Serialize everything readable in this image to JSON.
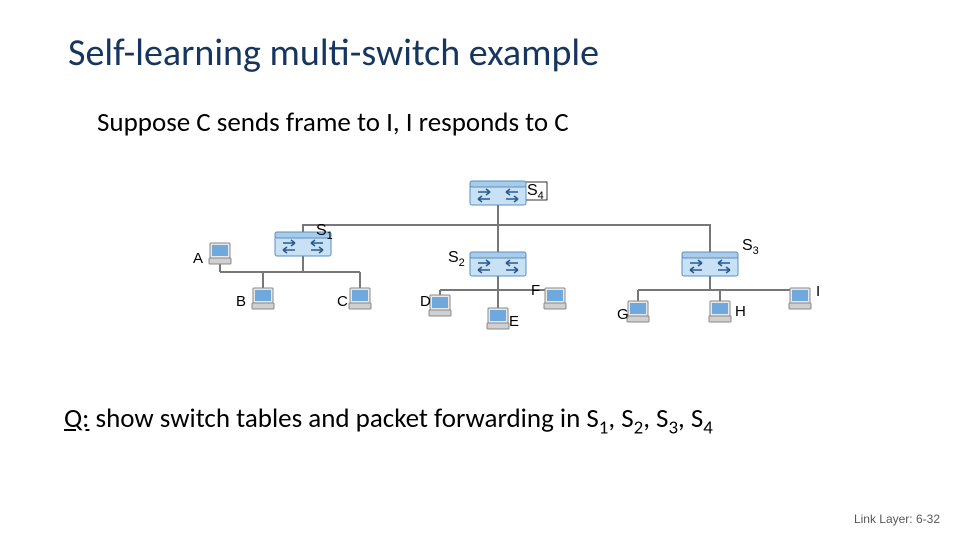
{
  "title": "Self-learning multi-switch example",
  "subtitle": "Suppose C sends frame to I, I responds to C",
  "question_prefix": "Q:",
  "question_body": " show switch tables and packet forwarding in S",
  "question_sep": ", S",
  "footer": "Link Layer: 6-32",
  "switches": {
    "s1": "S",
    "s2": "S",
    "s3": "S",
    "s4": "S",
    "n1": "1",
    "n2": "2",
    "n3": "3",
    "n4": "4"
  },
  "hosts": {
    "A": "A",
    "B": "B",
    "C": "C",
    "D": "D",
    "E": "E",
    "F": "F",
    "G": "G",
    "H": "H",
    "I": "I"
  }
}
